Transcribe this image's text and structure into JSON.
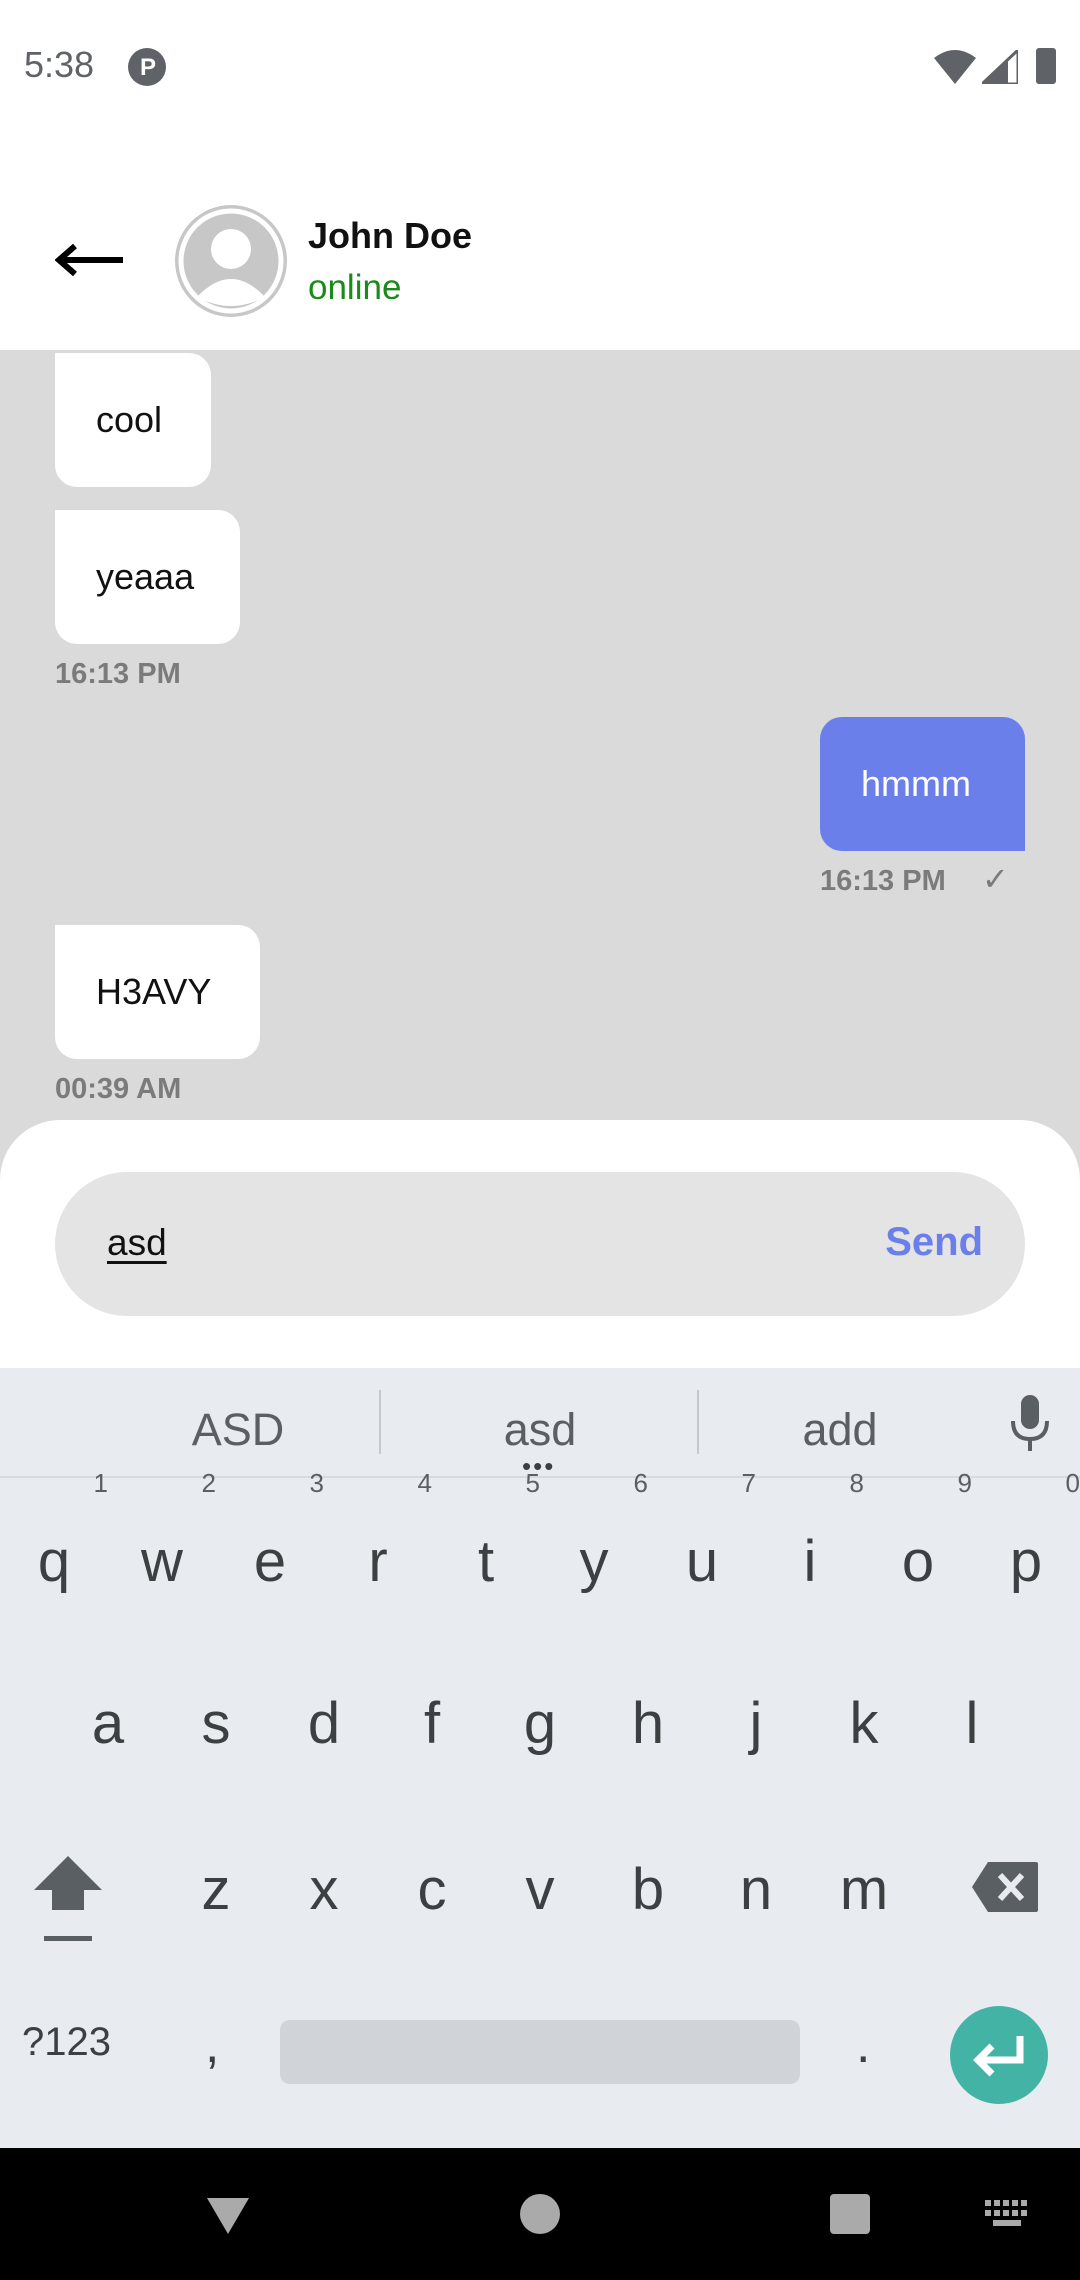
{
  "status_bar": {
    "time": "5:38",
    "app_icon_letter": "P"
  },
  "header": {
    "contact_name": "John Doe",
    "contact_status": "online"
  },
  "messages": [
    {
      "direction": "in",
      "text": "cool"
    },
    {
      "direction": "in",
      "text": "yeaaa",
      "timestamp": "16:13 PM"
    },
    {
      "direction": "out",
      "text": "hmmm",
      "timestamp": "16:13 PM",
      "read_mark": "✓"
    },
    {
      "direction": "in",
      "text": "H3AVY",
      "timestamp": "00:39 AM"
    }
  ],
  "composer": {
    "input_value": "asd",
    "send_label": "Send"
  },
  "keyboard": {
    "suggestions": [
      "ASD",
      "asd",
      "add"
    ],
    "row1": [
      "q",
      "w",
      "e",
      "r",
      "t",
      "y",
      "u",
      "i",
      "o",
      "p"
    ],
    "row1_hints": [
      "1",
      "2",
      "3",
      "4",
      "5",
      "6",
      "7",
      "8",
      "9",
      "0"
    ],
    "row2": [
      "a",
      "s",
      "d",
      "f",
      "g",
      "h",
      "j",
      "k",
      "l"
    ],
    "row3": [
      "z",
      "x",
      "c",
      "v",
      "b",
      "n",
      "m"
    ],
    "symbols_label": "?123",
    "comma": ",",
    "period": "."
  },
  "colors": {
    "accent": "#6b7fea",
    "online": "#1a8a1a",
    "enter": "#43b3a6"
  }
}
